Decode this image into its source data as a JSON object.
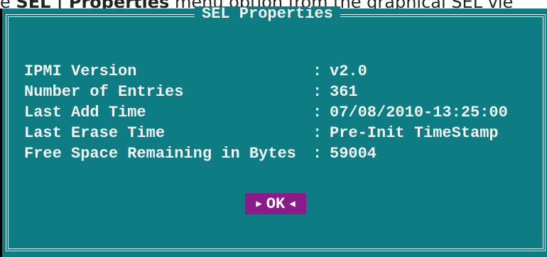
{
  "caption": {
    "text_before": "e ",
    "bold": "SEL | Properties",
    "text_after": " menu option from the graphical SEL vie"
  },
  "dialog": {
    "title": "SEL Properties",
    "properties": [
      {
        "label": "IPMI Version",
        "value": "v2.0"
      },
      {
        "label": "Number of Entries",
        "value": "361"
      },
      {
        "label": "Last Add Time",
        "value": "07/08/2010-13:25:00"
      },
      {
        "label": "Last Erase Time",
        "value": "Pre-Init TimeStamp"
      },
      {
        "label": "Free Space Remaining in Bytes",
        "value": "59004"
      }
    ],
    "separator": ":",
    "ok_label": "OK",
    "ok_left_icon": "right-triangle-icon",
    "ok_right_icon": "left-triangle-icon"
  },
  "colors": {
    "background": "#0e7d83",
    "text": "#f2f2f2",
    "button": "#8b1a8b"
  }
}
